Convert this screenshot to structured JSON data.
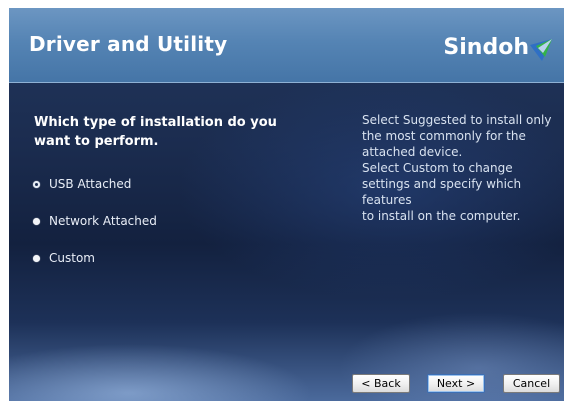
{
  "header": {
    "title": "Driver and Utility",
    "brand": "Sindoh"
  },
  "main": {
    "question": "Which type of installation do you want to perform.",
    "options": [
      {
        "label": "USB Attached",
        "selected": true
      },
      {
        "label": "Network Attached",
        "selected": false
      },
      {
        "label": "Custom",
        "selected": false
      }
    ],
    "description_lines": [
      "Select Suggested to install only",
      "the most commonly for the",
      "attached device.",
      "Select Custom to change",
      "settings and specify which",
      "features",
      "to install on the computer."
    ]
  },
  "footer": {
    "back_label": "< Back",
    "next_label": "Next >",
    "cancel_label": "Cancel"
  },
  "icons": {
    "brand_logo": "sindoh-logo-icon"
  },
  "colors": {
    "header": "#5584b4",
    "background": "#1b2c4f",
    "logo_blue": "#2f6fc4",
    "logo_green": "#33b24a"
  }
}
